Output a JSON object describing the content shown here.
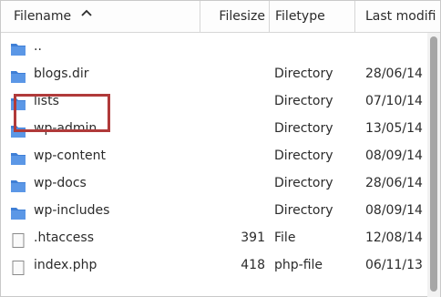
{
  "columns": {
    "filename": "Filename",
    "filesize": "Filesize",
    "filetype": "Filetype",
    "last_modified": "Last modifi"
  },
  "sort_indicator": "^",
  "files": [
    {
      "name": "..",
      "size": "",
      "type": "",
      "date": "",
      "icon": "folder-icon"
    },
    {
      "name": "blogs.dir",
      "size": "",
      "type": "Directory",
      "date": "28/06/14",
      "icon": "folder-icon"
    },
    {
      "name": "lists",
      "size": "",
      "type": "Directory",
      "date": "07/10/14",
      "icon": "folder-icon"
    },
    {
      "name": "wp-admin",
      "size": "",
      "type": "Directory",
      "date": "13/05/14",
      "icon": "folder-icon"
    },
    {
      "name": "wp-content",
      "size": "",
      "type": "Directory",
      "date": "08/09/14",
      "icon": "folder-icon"
    },
    {
      "name": "wp-docs",
      "size": "",
      "type": "Directory",
      "date": "28/06/14",
      "icon": "folder-icon"
    },
    {
      "name": "wp-includes",
      "size": "",
      "type": "Directory",
      "date": "08/09/14",
      "icon": "folder-icon"
    },
    {
      "name": ".htaccess",
      "size": "391",
      "type": "File",
      "date": "12/08/14",
      "icon": "file-icon"
    },
    {
      "name": "index.php",
      "size": "418",
      "type": "php-file",
      "date": "06/11/13",
      "icon": "file-icon"
    }
  ],
  "colors": {
    "folder": "#3f7fd6",
    "highlight_border": "#b03a3a",
    "scroll_thumb": "#a6a6a6"
  }
}
